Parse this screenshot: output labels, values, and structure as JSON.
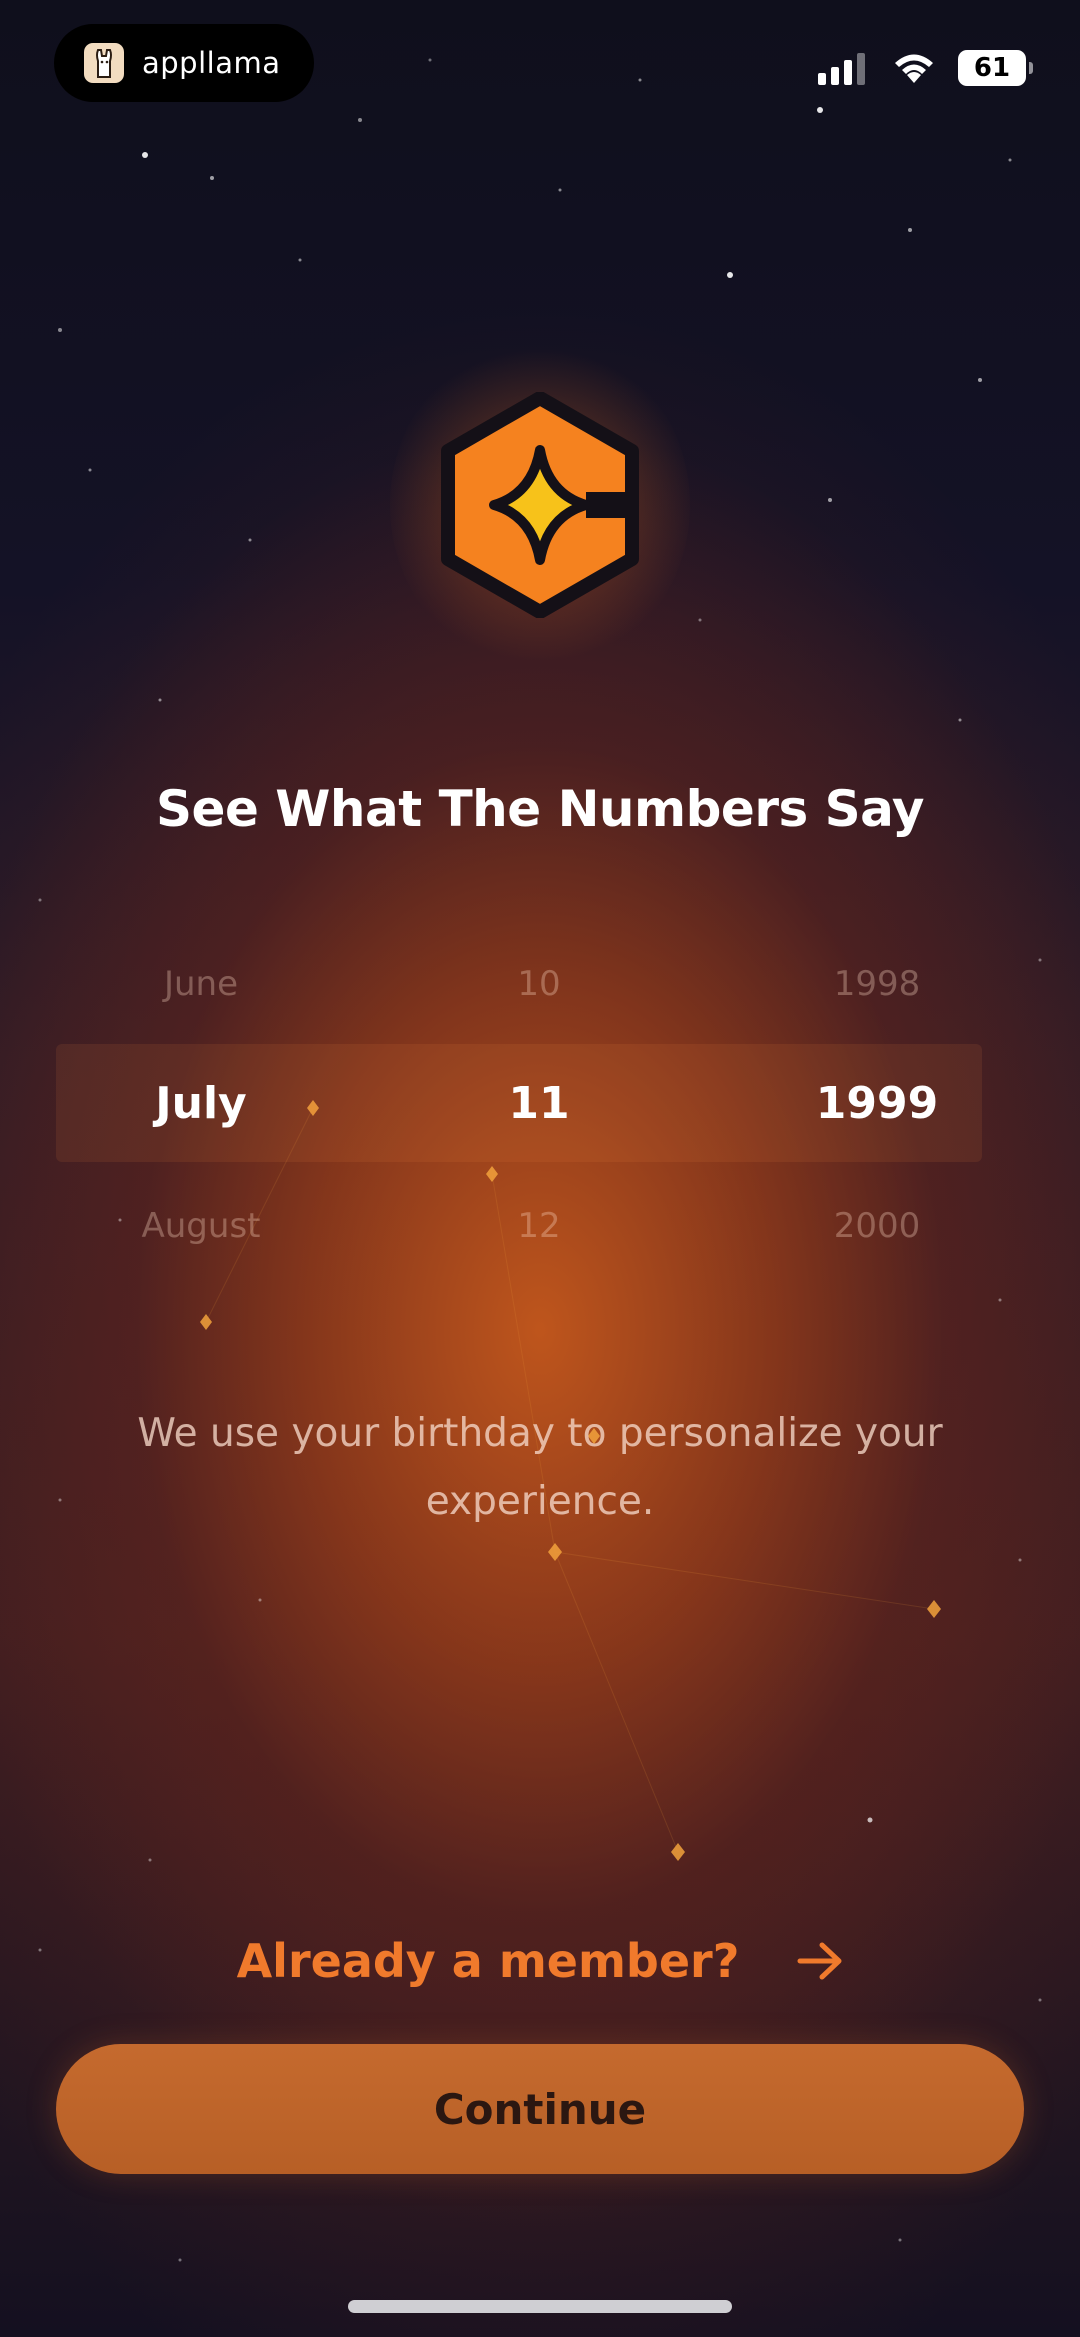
{
  "status_bar": {
    "app_name": "appllama",
    "battery": "61"
  },
  "title": "See What The Numbers Say",
  "date_picker": {
    "rows": [
      {
        "month": "June",
        "day": "10",
        "year": "1998"
      },
      {
        "month": "July",
        "day": "11",
        "year": "1999"
      },
      {
        "month": "August",
        "day": "12",
        "year": "2000"
      }
    ],
    "selected": {
      "month": "July",
      "day": "11",
      "year": "1999"
    }
  },
  "description": "We use your birthday to personalize your experience.",
  "member_link": {
    "label": "Already a member?",
    "icon": "arrow-right-icon"
  },
  "continue_button": {
    "label": "Continue"
  },
  "colors": {
    "accent": "#f07a2c",
    "button": "#c0662b",
    "logo_orange": "#f5821f",
    "logo_star": "#f7c21a"
  }
}
